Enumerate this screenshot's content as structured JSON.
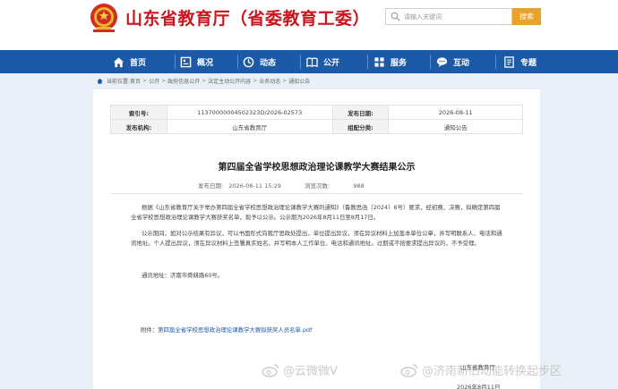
{
  "header": {
    "site_title": "山东省教育厅（省委教育工委）",
    "search": {
      "placeholder": "请输入关键词",
      "button_label": "搜索"
    }
  },
  "nav": {
    "items": [
      {
        "label": "首页",
        "icon": "home-icon"
      },
      {
        "label": "概况",
        "icon": "overview-icon"
      },
      {
        "label": "动态",
        "icon": "news-icon"
      },
      {
        "label": "公开",
        "icon": "book-icon"
      },
      {
        "label": "服务",
        "icon": "service-icon"
      },
      {
        "label": "互动",
        "icon": "interact-icon"
      },
      {
        "label": "专题",
        "icon": "topic-icon"
      }
    ]
  },
  "breadcrumb": {
    "prefix": "当前位置:",
    "items": [
      "首页",
      "公开",
      "政府信息公开",
      "法定主动公开内容",
      "业务动态",
      "通知公告"
    ],
    "separator": ">"
  },
  "meta": {
    "index_label": "索引号:",
    "index_value": "11370000004502323D/2026-02573",
    "date_label": "发布日期:",
    "date_value": "2026-08-11",
    "org_label": "发布机构:",
    "org_value": "山东省教育厅",
    "category_label": "组配分类:",
    "category_value": "通知公告"
  },
  "article": {
    "title": "第四届全省学校思想政治理论课教学大赛结果公示",
    "pub_date_label": "发布日期:",
    "pub_date_value": "2026-08-11 15:29",
    "views_label": "浏览次数:",
    "views_value": "988",
    "paragraph1": "根据《山东省教育厅关于举办第四届全省学校思想政治理论课教学大赛的通知》（鲁教思函〔2024〕6号）要求，经初赛、决赛，拟确定第四届全省学校思想政治理论课教学大赛获奖名单，现予以公示。公示期为2026年8月11日至8月17日。",
    "paragraph2": "公示期间，如对公示结果有异议，可以书面形式向我厅思政处提出，单位提出异议，须在异议材料上加盖本单位公章，并写明联系人、电话和通讯地址。个人提出异议，须在异议材料上签署真实姓名，并写明本人工作单位、电话和通讯地址。过期或不按要求提出异议的，不予受理。",
    "paragraph3": "通讯地址：济南市舜耕路60号。",
    "attachment_label": "附件：",
    "attachment_link": "第四届全省学校思想政治理论课教学大赛拟获奖人员名单.pdf",
    "sign_org": "山东省教育厅",
    "sign_date": "2026年8月11日"
  },
  "watermarks": [
    "@云微微V",
    "@济南新旧动能转换起步区"
  ],
  "colors": {
    "brand_red": "#c9151e",
    "nav_blue": "#1c5aa8",
    "search_orange": "#e8a229",
    "page_bg": "#eaf0f7"
  }
}
